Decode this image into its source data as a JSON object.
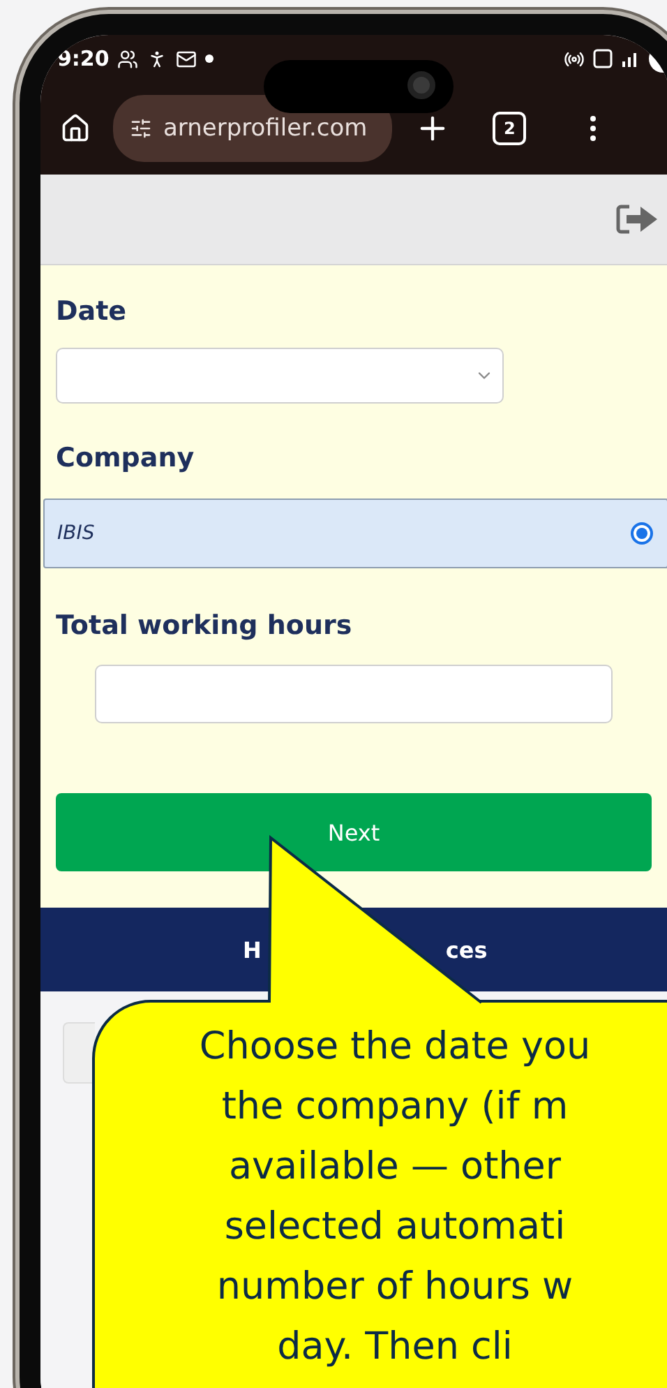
{
  "status_bar": {
    "time": "9:20"
  },
  "browser": {
    "url": "arnerprofiler.com",
    "tab_count": "2"
  },
  "form": {
    "date": {
      "label": "Date"
    },
    "company": {
      "label": "Company",
      "options": [
        {
          "name": "IBIS",
          "selected": true
        }
      ]
    },
    "hours": {
      "label": "Total working hours"
    },
    "next_button": "Next"
  },
  "nav": {
    "text_parts": [
      "H",
      "ces"
    ]
  },
  "callout": {
    "lines": [
      "Choose the date you",
      "the company (if m",
      "available — other",
      "selected automati",
      "number of hours w",
      "day. Then cli"
    ]
  }
}
